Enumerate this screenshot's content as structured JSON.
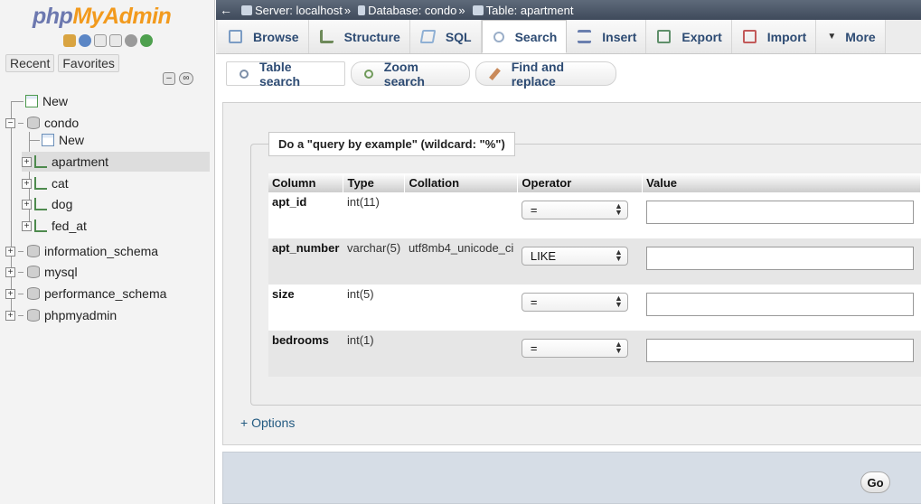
{
  "app": {
    "logo_php": "php",
    "logo_myadmin": "MyAdmin"
  },
  "nav": {
    "recent": "Recent",
    "favorites": "Favorites",
    "tree": [
      {
        "label": "New",
        "level": 0,
        "kind": "new"
      },
      {
        "label": "condo",
        "level": 0,
        "kind": "db",
        "expanded": true
      },
      {
        "label": "New",
        "level": 1,
        "kind": "new"
      },
      {
        "label": "apartment",
        "level": 1,
        "kind": "table",
        "selected": true
      },
      {
        "label": "cat",
        "level": 1,
        "kind": "table"
      },
      {
        "label": "dog",
        "level": 1,
        "kind": "table"
      },
      {
        "label": "fed_at",
        "level": 1,
        "kind": "table"
      },
      {
        "label": "information_schema",
        "level": 0,
        "kind": "db"
      },
      {
        "label": "mysql",
        "level": 0,
        "kind": "db"
      },
      {
        "label": "performance_schema",
        "level": 0,
        "kind": "db"
      },
      {
        "label": "phpmyadmin",
        "level": 0,
        "kind": "db"
      }
    ]
  },
  "breadcrumb": {
    "server": "Server: localhost",
    "database": "Database: condo",
    "table": "Table: apartment",
    "separator": "»"
  },
  "tabs": [
    {
      "label": "Browse",
      "icon": "browse-icon",
      "color": "#7b9cc4"
    },
    {
      "label": "Structure",
      "icon": "structure-icon",
      "color": "#6e8a5a"
    },
    {
      "label": "SQL",
      "icon": "sql-icon",
      "color": "#8fb0d4"
    },
    {
      "label": "Search",
      "icon": "search-icon",
      "color": "#9aaec8",
      "active": true
    },
    {
      "label": "Insert",
      "icon": "insert-icon",
      "color": "#6a7fae"
    },
    {
      "label": "Export",
      "icon": "export-icon",
      "color": "#5f8f6a"
    },
    {
      "label": "Import",
      "icon": "import-icon",
      "color": "#c25a5a"
    },
    {
      "label": "More",
      "icon": "chevron-down-icon",
      "color": "#444444"
    }
  ],
  "subtabs": [
    {
      "label": "Table search",
      "icon": "magnifier-icon",
      "active": true
    },
    {
      "label": "Zoom search",
      "icon": "zoom-icon"
    },
    {
      "label": "Find and replace",
      "icon": "replace-icon"
    }
  ],
  "query": {
    "legend": "Do a \"query by example\" (wildcard: \"%\")",
    "headers": [
      "Column",
      "Type",
      "Collation",
      "Operator",
      "Value"
    ],
    "rows": [
      {
        "column": "apt_id",
        "type": "int(11)",
        "collation": "",
        "operator": "=",
        "value": ""
      },
      {
        "column": "apt_number",
        "type": "varchar(5)",
        "collation": "utf8mb4_unicode_ci",
        "operator": "LIKE",
        "value": ""
      },
      {
        "column": "size",
        "type": "int(5)",
        "collation": "",
        "operator": "=",
        "value": ""
      },
      {
        "column": "bedrooms",
        "type": "int(1)",
        "collation": "",
        "operator": "=",
        "value": ""
      }
    ]
  },
  "options_link": "+ Options",
  "go_label": "Go",
  "colors": {
    "link": "#235a81",
    "logo_php": "#6c78af",
    "logo_myadmin": "#f29a1d"
  }
}
